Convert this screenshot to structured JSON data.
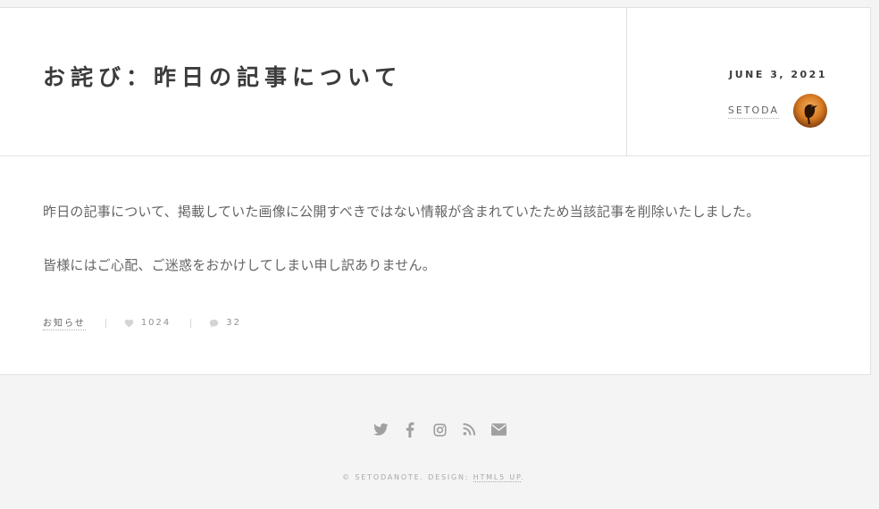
{
  "post": {
    "title": "お詫び：昨日の記事について",
    "date": "JUNE 3, 2021",
    "author": "SETODA",
    "paragraphs": [
      "昨日の記事について、掲載していた画像に公開すべきではない情報が含まれていたため当該記事を削除いたしました。",
      "皆様にはご心配、ご迷惑をおかけしてしまい申し訳ありません。"
    ],
    "category": "お知らせ",
    "likes": "1024",
    "comments": "32"
  },
  "footer": {
    "icons": [
      "twitter-icon",
      "facebook-icon",
      "instagram-icon",
      "rss-icon",
      "envelope-icon"
    ],
    "copyright_prefix": "© SETODANOTE. DESIGN: ",
    "design_link": "HTML5 UP",
    "copyright_suffix": "."
  },
  "colors": {
    "text": "#3c3b3b",
    "muted": "#646464",
    "icon": "#a0a0a0",
    "background": "#f4f4f4"
  }
}
